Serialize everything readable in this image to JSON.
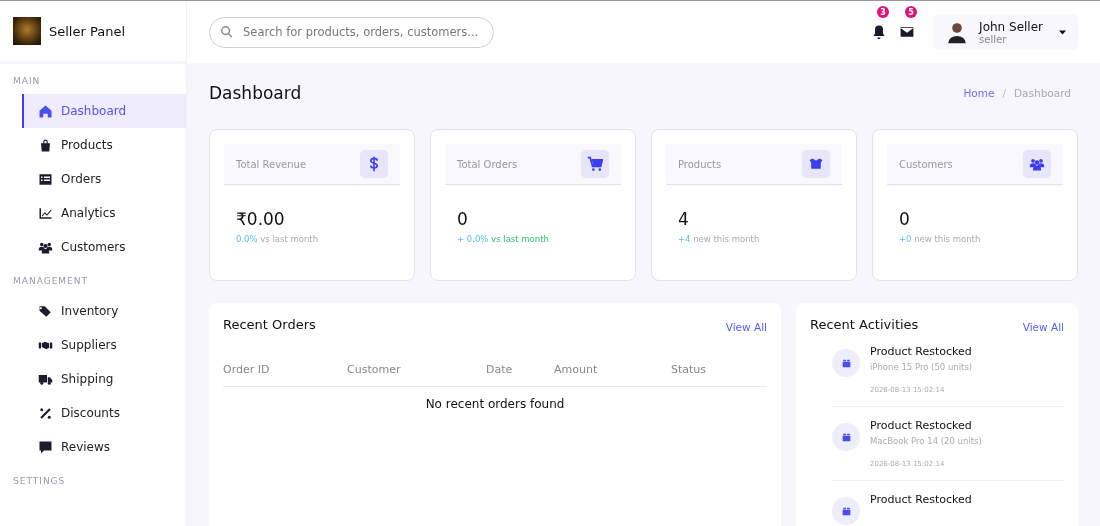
{
  "brand": {
    "title": "Seller Panel"
  },
  "sidebar": {
    "sections": [
      {
        "heading": "MAIN",
        "items": [
          {
            "label": "Dashboard",
            "selected": true
          },
          {
            "label": "Products",
            "selected": false
          },
          {
            "label": "Orders",
            "selected": false
          },
          {
            "label": "Analytics",
            "selected": false
          },
          {
            "label": "Customers",
            "selected": false
          }
        ]
      },
      {
        "heading": "MANAGEMENT",
        "items": [
          {
            "label": "Inventory",
            "selected": false
          },
          {
            "label": "Suppliers",
            "selected": false
          },
          {
            "label": "Shipping",
            "selected": false
          },
          {
            "label": "Discounts",
            "selected": false
          },
          {
            "label": "Reviews",
            "selected": false
          }
        ]
      },
      {
        "heading": "SETTINGS"
      }
    ]
  },
  "search": {
    "placeholder": "Search for products, orders, customers..."
  },
  "header": {
    "notifications": "3",
    "messages": "5",
    "user": {
      "name": "John Seller",
      "role": "seller"
    }
  },
  "page": {
    "title": "Dashboard",
    "breadcrumb_separator": "/",
    "breadcrumb": [
      {
        "label": "Home",
        "selected": false
      },
      {
        "label": "Dashboard",
        "selected": true
      }
    ]
  },
  "stats": [
    {
      "label": "Total Revenue",
      "value": "₹0.00",
      "change": "0.0%",
      "note": "vs last month",
      "kind": "neutral"
    },
    {
      "label": "Total Orders",
      "value": "0",
      "change": "+ 0.0%",
      "note": "vs last month",
      "kind": "positive"
    },
    {
      "label": "Products",
      "value": "4",
      "change": "+4",
      "note": "new this month",
      "kind": "neutral"
    },
    {
      "label": "Customers",
      "value": "0",
      "change": "+0",
      "note": "new this month",
      "kind": "neutral"
    }
  ],
  "recent_orders": {
    "title": "Recent Orders",
    "link": "View All",
    "columns": [
      "Order ID",
      "Customer",
      "Date",
      "Amount",
      "Status"
    ],
    "empty": "No recent orders found"
  },
  "recent_activities": {
    "title": "Recent Activities",
    "link": "View All",
    "items": [
      {
        "title": "Product Restocked",
        "detail": "iPhone 15 Pro (50 units)",
        "time": "2026-08-13 15:02:14"
      },
      {
        "title": "Product Restocked",
        "detail": "MacBook Pro 14 (20 units)",
        "time": "2026-08-13 15:02:14"
      },
      {
        "title": "Product Restocked"
      }
    ]
  }
}
